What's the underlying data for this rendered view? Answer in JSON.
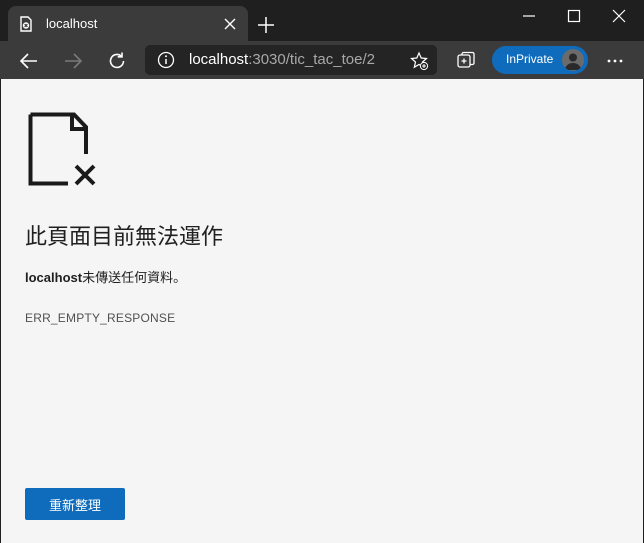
{
  "tab": {
    "title": "localhost"
  },
  "address_bar": {
    "host": "localhost",
    "path": ":3030/tic_tac_toe/2"
  },
  "profile": {
    "label": "InPrivate"
  },
  "error_page": {
    "heading": "此頁面目前無法運作",
    "host": "localhost",
    "message": "未傳送任何資料。",
    "code": "ERR_EMPTY_RESPONSE",
    "reload_label": "重新整理"
  },
  "colors": {
    "accent": "#0f6cbd",
    "titlebar": "#1f1f1f",
    "toolbar": "#3b3b3b",
    "page_bg": "#f5f5f5"
  },
  "icons": [
    "document-error-icon",
    "tab-favicon-icon",
    "close-icon",
    "plus-icon",
    "minimize-icon",
    "maximize-icon",
    "window-close-icon",
    "back-icon",
    "forward-icon",
    "refresh-icon",
    "info-icon",
    "favorite-add-icon",
    "collections-icon",
    "avatar",
    "more-icon"
  ]
}
